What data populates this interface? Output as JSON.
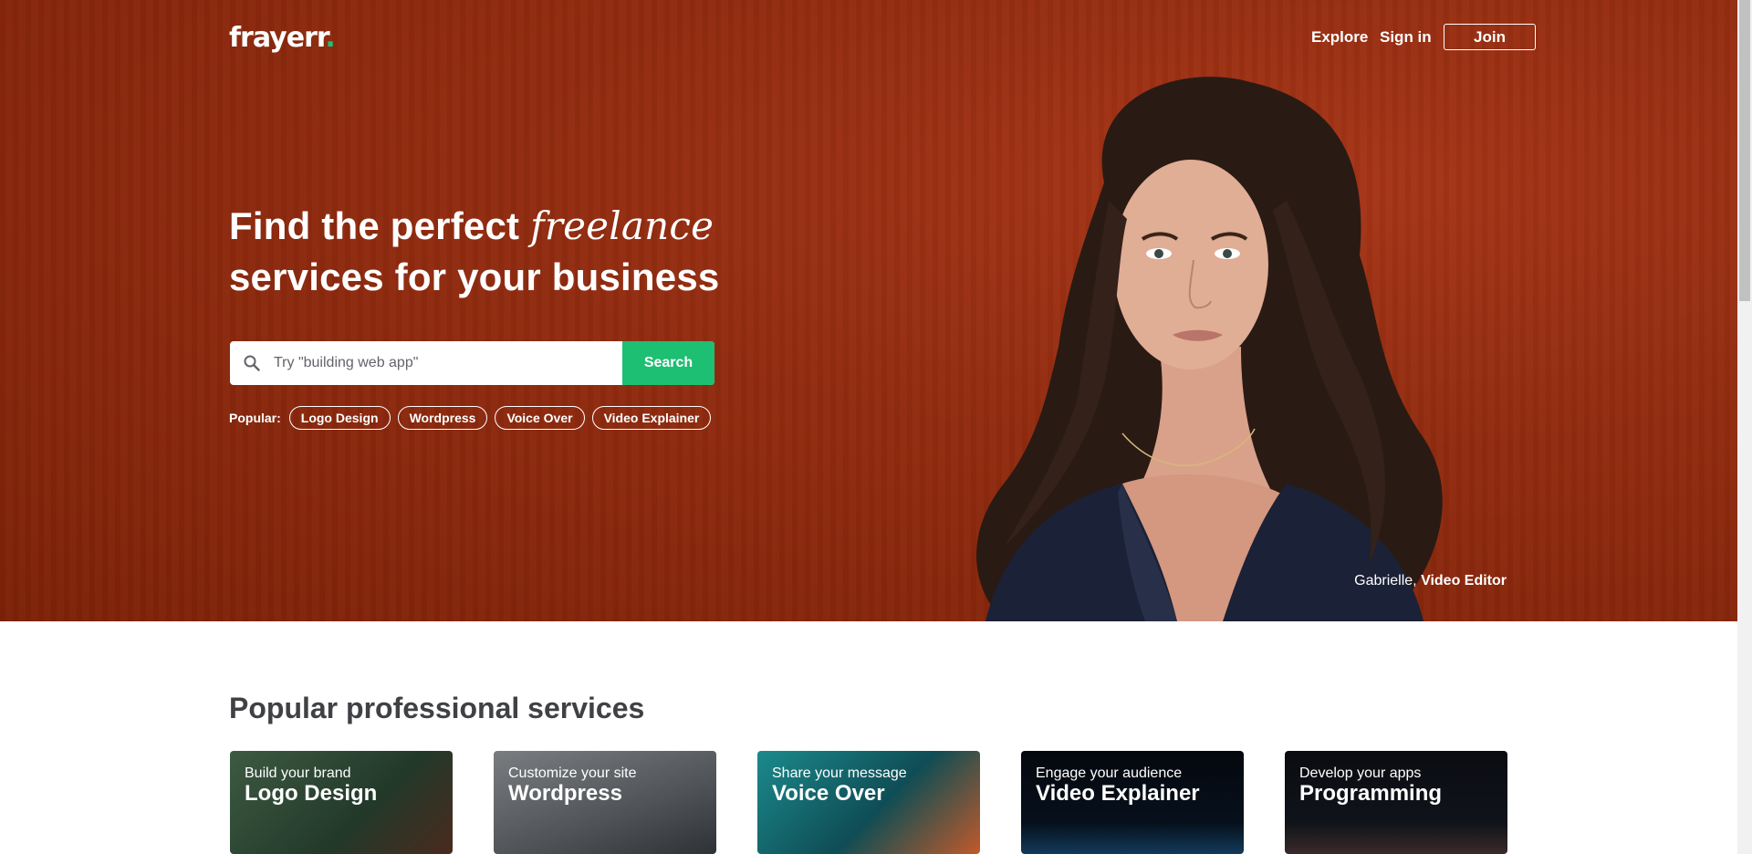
{
  "header": {
    "logo_text": "frayerr",
    "logo_dot": ".",
    "nav": {
      "explore": "Explore",
      "signin": "Sign in",
      "join": "Join"
    }
  },
  "hero": {
    "headline_part1": "Find the perfect ",
    "headline_italic": "freelance",
    "headline_part2": "services for your business",
    "search": {
      "placeholder": "Try \"building web app\"",
      "button": "Search"
    },
    "popular_label": "Popular:",
    "popular_chips": [
      "Logo Design",
      "Wordpress",
      "Voice Over",
      "Video Explainer"
    ],
    "caption_name": "Gabrielle,",
    "caption_role": "Video Editor"
  },
  "services": {
    "title": "Popular professional services",
    "cards": [
      {
        "sub": "Build your brand",
        "title": "Logo Design",
        "color": "#2f4a35"
      },
      {
        "sub": "Customize your site",
        "title": "Wordpress",
        "color": "#5b5f63"
      },
      {
        "sub": "Share your message",
        "title": "Voice Over",
        "color": "#1e6b70"
      },
      {
        "sub": "Engage your audience",
        "title": "Video Explainer",
        "color": "#050a12"
      },
      {
        "sub": "Develop your apps",
        "title": "Programming",
        "color": "#0b0d12"
      }
    ]
  },
  "colors": {
    "brand_green": "#1dbf73",
    "hero_bg": "#922c10",
    "heading_text": "#404145"
  }
}
